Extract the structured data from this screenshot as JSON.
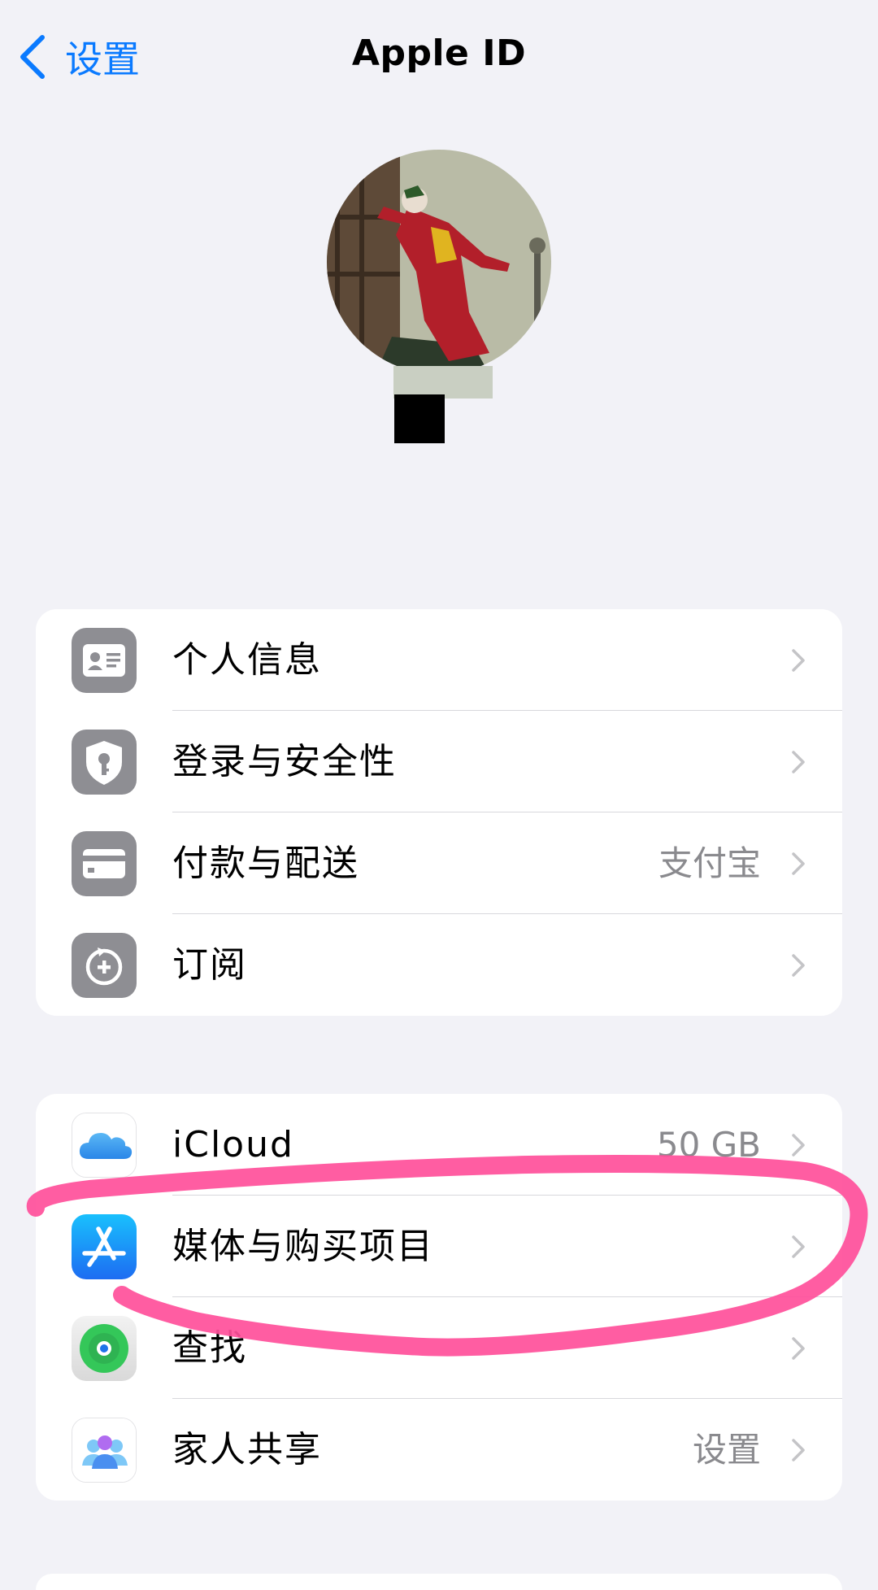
{
  "nav": {
    "back_label": "设置",
    "title": "Apple ID"
  },
  "group1": [
    {
      "label": "个人信息",
      "value": "",
      "icon": "contact-card-icon"
    },
    {
      "label": "登录与安全性",
      "value": "",
      "icon": "shield-key-icon"
    },
    {
      "label": "付款与配送",
      "value": "支付宝",
      "icon": "credit-card-icon"
    },
    {
      "label": "订阅",
      "value": "",
      "icon": "subscription-icon"
    }
  ],
  "group2": [
    {
      "label": "iCloud",
      "value": "50 GB",
      "icon": "icloud-icon"
    },
    {
      "label": "媒体与购买项目",
      "value": "",
      "icon": "app-store-icon"
    },
    {
      "label": "查找",
      "value": "",
      "icon": "find-my-icon"
    },
    {
      "label": "家人共享",
      "value": "设置",
      "icon": "family-sharing-icon"
    }
  ],
  "colors": {
    "accent": "#0a7aff",
    "annotation": "#ff4f9a",
    "background": "#f2f2f7"
  }
}
